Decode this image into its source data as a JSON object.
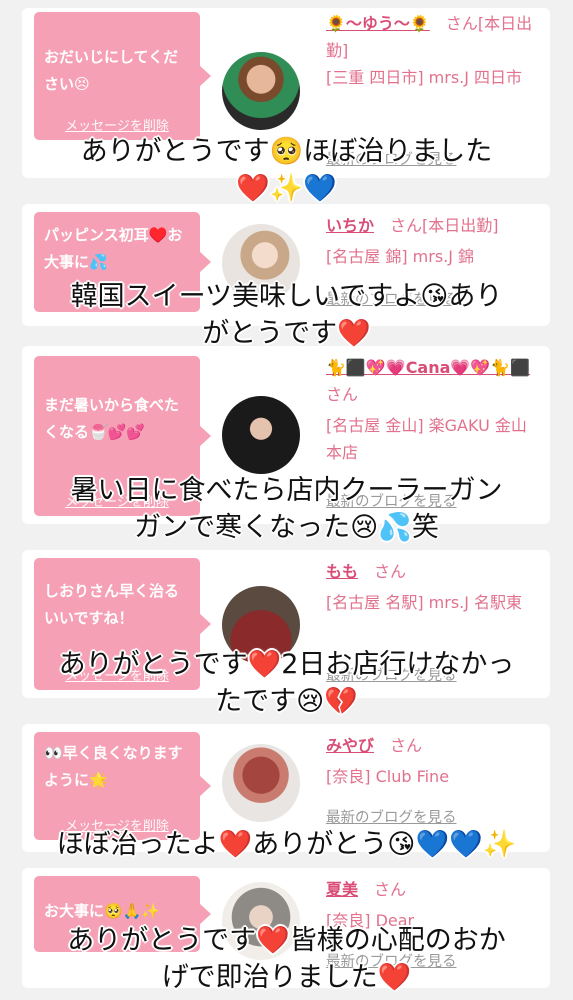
{
  "colors": {
    "page_bg": "#f1f1f1",
    "bubble": "#f5a0b5",
    "name": "#d94d77",
    "meta": "#e2718d",
    "link_gray": "#9a9a9a"
  },
  "delete_label": "メッセージを削除",
  "blog_label": "最新のブログを見る",
  "san": "さん",
  "cards": [
    {
      "message": "おだいじにしてください😣",
      "name": "🌻〜ゆう〜🌻",
      "suffix": "さん[本日出勤]",
      "shop": "[三重 四日市] mrs.J 四日市",
      "overlay_line1": "ありがとうです🥺ほぼ治りました",
      "overlay_line2": "❤️✨💙"
    },
    {
      "message": "パッピンス初耳♥️お大事に💦",
      "name": "いちか",
      "suffix": "さん[本日出勤]",
      "shop": "[名古屋 錦] mrs.J 錦",
      "overlay_line1": "韓国スイーツ美味しいですよ😘あり",
      "overlay_line2": "がとうです❤️"
    },
    {
      "message": "まだ暑いから食べたくなる🍧💕💕",
      "name": "🐈⬛💖💗Cana💗💖🐈⬛",
      "suffix": "さん",
      "shop": "[名古屋 金山] 楽GAKU 金山本店",
      "overlay_line1": "暑い日に食べたら店内クーラーガン",
      "overlay_line2": "ガンで寒くなった😢💦笑"
    },
    {
      "message": "しおりさん早く治るいいですね！",
      "name": "もも",
      "suffix": "さん",
      "shop": "[名古屋 名駅] mrs.J 名駅東",
      "overlay_line1": "ありがとうです❤️2日お店行けなかっ",
      "overlay_line2": "たです😢💔"
    },
    {
      "message": "👀早く良くなりますように🌟",
      "name": "みやび",
      "suffix": "さん",
      "shop": "[奈良] Club Fine",
      "overlay_line1": "ほぼ治ったよ❤️ありがとう😘💙💙✨",
      "overlay_line2": ""
    },
    {
      "message": "お大事に🥺🙏✨",
      "name": "夏美",
      "suffix": "さん",
      "shop": "[奈良] Dear",
      "overlay_line1": "ありがとうです❤️皆様の心配のおか",
      "overlay_line2": "げで即治りました❤️"
    }
  ]
}
